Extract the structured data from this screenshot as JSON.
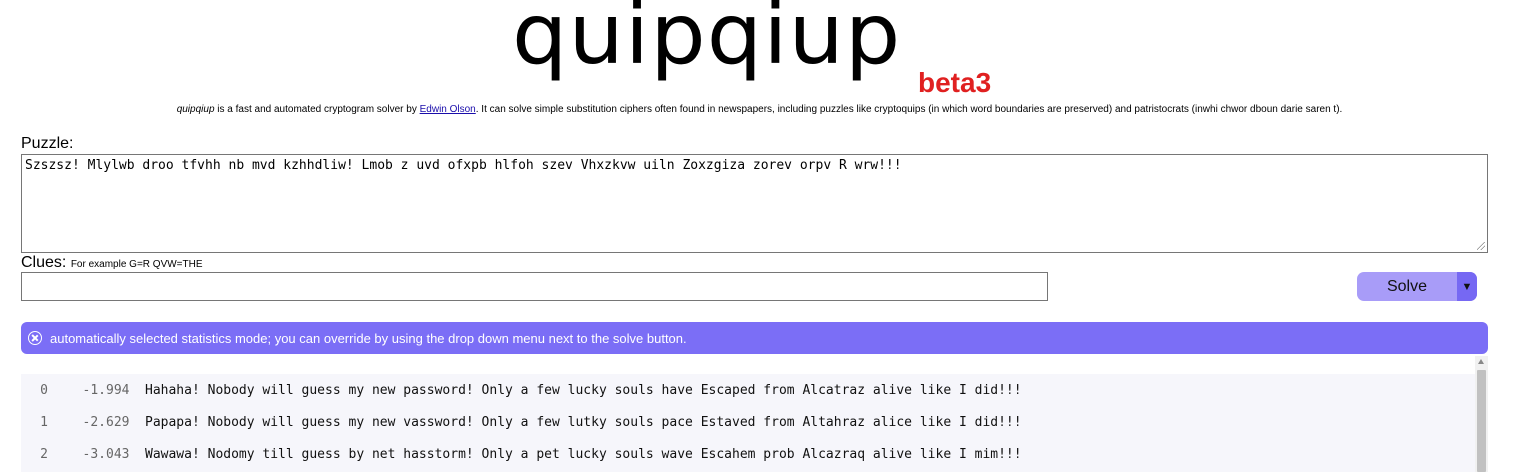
{
  "header": {
    "logo": "quipqiup",
    "beta": "beta3",
    "tagline": {
      "name": "quipqiup",
      "text1": " is a fast and automated cryptogram solver by ",
      "author": "Edwin Olson",
      "text2": ". It can solve simple substitution ciphers often found in newspapers, including puzzles like cryptoquips (in which word boundaries are preserved) and patristocrats (inwhi chwor dboun darie saren t)."
    }
  },
  "puzzle": {
    "label": "Puzzle:",
    "value": "Szszsz! Mlylwb droo tfvhh nb mvd kzhhdliw! Lmob z uvd ofxpb hlfoh szev Vhxzkvw uiln Zoxzgiza zorev orpv R wrw!!!"
  },
  "clues": {
    "label": "Clues:",
    "hint": "For example G=R QVW=THE",
    "value": ""
  },
  "solve": {
    "label": "Solve",
    "dropdown": "▼"
  },
  "banner": {
    "icon": "close-circle-icon",
    "message": "automatically selected statistics mode; you can override by using the drop down menu next to the solve button."
  },
  "results": [
    {
      "index": "0",
      "score": "-1.994",
      "text": "Hahaha! Nobody will guess my new password! Only a few lucky souls have Escaped from Alcatraz alive like I did!!!"
    },
    {
      "index": "1",
      "score": "-2.629",
      "text": "Papapa! Nobody will guess my new vassword! Only a few lutky souls pace Estaved from Altahraz alice like I did!!!"
    },
    {
      "index": "2",
      "score": "-3.043",
      "text": "Wawawa! Nodomy till guess by net hasstorm! Only a pet lucky souls wave Escahem prob Alcazraq alive like I mim!!!"
    }
  ],
  "colors": {
    "accent": "#7b6ef6",
    "solve_button": "#a89cf8",
    "beta": "#e02020",
    "link": "#1a0dab"
  }
}
